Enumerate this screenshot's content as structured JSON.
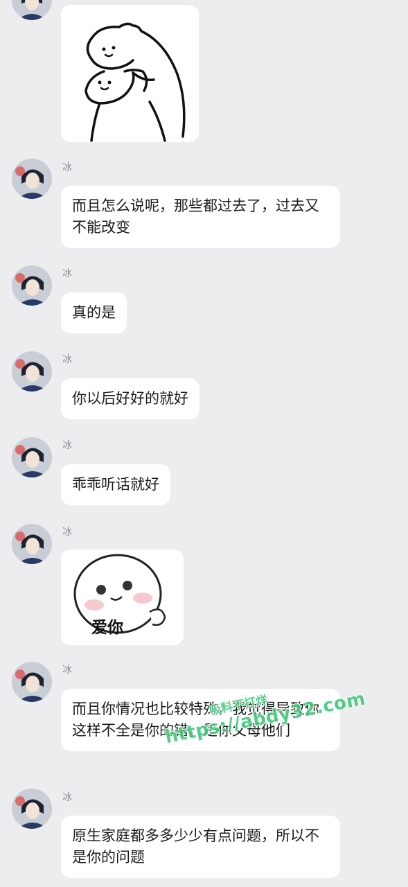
{
  "sender": "冰",
  "messages": [
    {
      "type": "text",
      "text": "而且怎么说呢，那些都过去了，过去又不能改变"
    },
    {
      "type": "text",
      "text": "真的是"
    },
    {
      "type": "text",
      "text": "你以后好好的就好"
    },
    {
      "type": "text",
      "text": "乖乖听话就好"
    },
    {
      "type": "sticker",
      "caption": "爱你"
    },
    {
      "type": "text",
      "text": "而且你情况也比较特殊，我觉得导致你这样不全是你的错，是你父母他们"
    },
    {
      "type": "text",
      "text": "原生家庭都多多少少有点问题，所以不是你的问题"
    }
  ],
  "watermark": {
    "line1": "吸料不打烊",
    "line2": "https://abdy32.com"
  },
  "colors": {
    "background": "#ededf0",
    "bubble": "#ffffff",
    "watermark": "#3fc97a"
  }
}
